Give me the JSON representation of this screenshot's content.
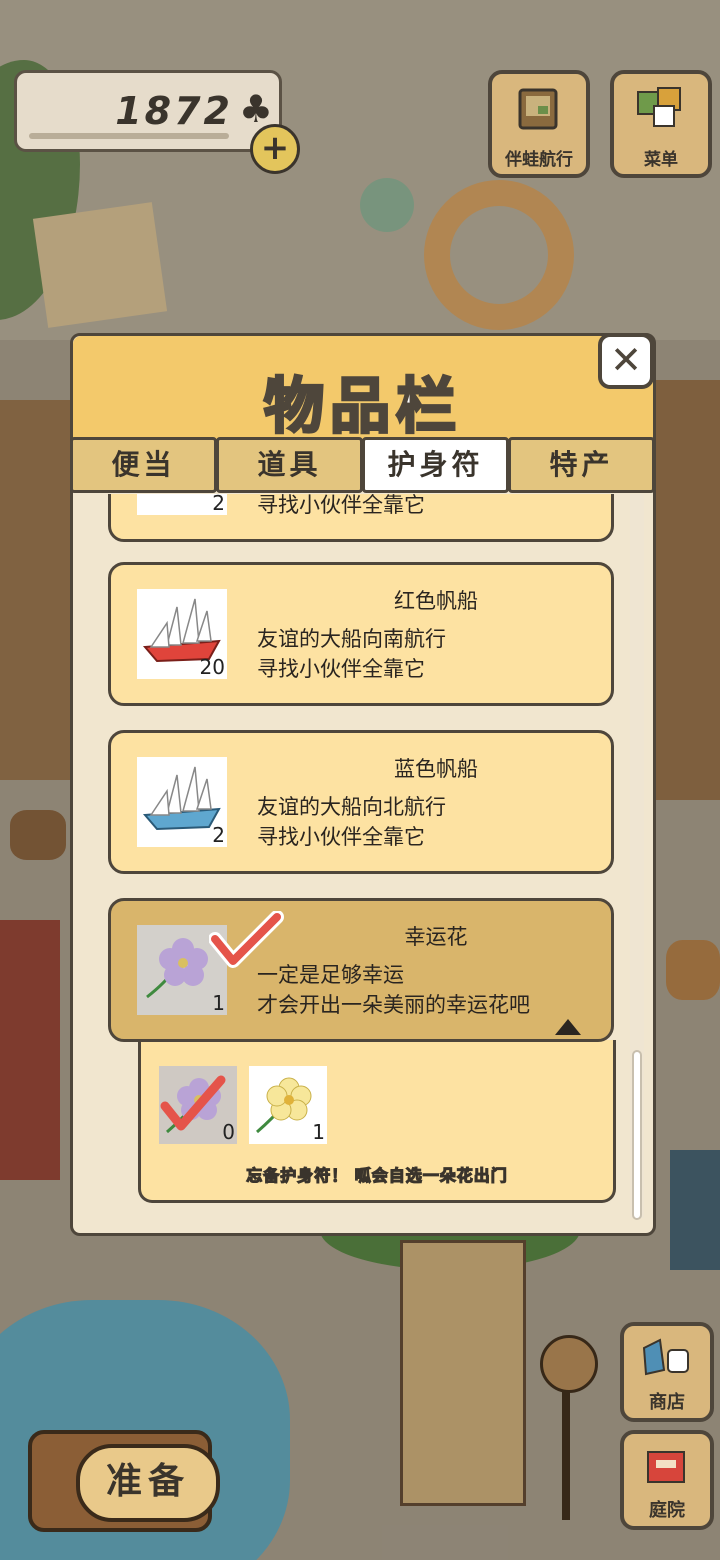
{
  "currency": {
    "count": "1872",
    "icon": "clover-icon"
  },
  "top_buttons": [
    {
      "label": "伴蛙航行",
      "icon": "map-icon"
    },
    {
      "label": "菜单",
      "icon": "menu-icon"
    }
  ],
  "panel": {
    "title": "物品栏",
    "tabs": [
      {
        "label": "便当",
        "active": false
      },
      {
        "label": "道具",
        "active": false
      },
      {
        "label": "护身符",
        "active": true
      },
      {
        "label": "特产",
        "active": false
      }
    ],
    "partial_item": {
      "qty": "2",
      "line": "寻找小伙伴全靠它"
    },
    "items": [
      {
        "title": "红色帆船",
        "line1": "友谊的大船向南航行",
        "line2": "寻找小伙伴全靠它",
        "qty": "20",
        "icon": "red-sailboat-icon"
      },
      {
        "title": "蓝色帆船",
        "line1": "友谊的大船向北航行",
        "line2": "寻找小伙伴全靠它",
        "qty": "2",
        "icon": "blue-sailboat-icon"
      },
      {
        "title": "幸运花",
        "line1": "一定是足够幸运",
        "line2": "才会开出一朵美丽的幸运花吧",
        "qty": "1",
        "icon": "lucky-flower-icon"
      }
    ],
    "variants": [
      {
        "qty": "0",
        "icon": "purple-flower-icon",
        "checked": true
      },
      {
        "qty": "1",
        "icon": "yellow-flower-icon",
        "checked": false
      }
    ],
    "note": "忘备护身符！ 呱会自选一朵花出门"
  },
  "side_buttons": [
    {
      "label": "商店",
      "icon": "shop-icon"
    },
    {
      "label": "庭院",
      "icon": "garden-icon"
    }
  ],
  "prepare_label": "准备",
  "colors": {
    "panel_header": "#f3c96b",
    "card": "#fde2a2",
    "card_selected": "#d9b56b",
    "outline": "#4e463b",
    "check": "#e5544a"
  }
}
